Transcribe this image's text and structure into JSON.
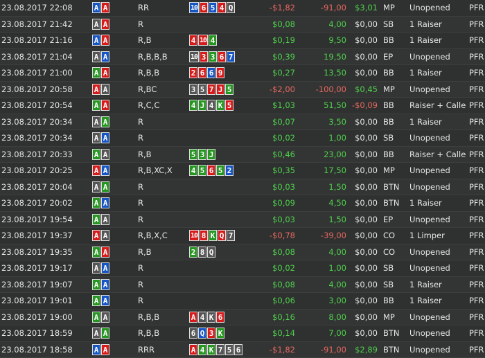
{
  "rows": [
    {
      "date": "23.08.2017 22:08",
      "hole": [
        [
          "A",
          "b"
        ],
        [
          "A",
          "r"
        ]
      ],
      "action": "RR",
      "board": [
        [
          "10",
          "b"
        ],
        [
          "6",
          "r"
        ],
        [
          "5",
          "b"
        ],
        [
          "4",
          "r"
        ],
        [
          "Q",
          "k"
        ]
      ],
      "net": "-$1,82",
      "net_c": "neg",
      "bb": "-91,00",
      "bb_c": "neg",
      "ev": "$3,01",
      "ev_c": "green",
      "pos": "MP",
      "sit": "Unopened",
      "pfr": "PFR"
    },
    {
      "date": "23.08.2017 21:42",
      "hole": [
        [
          "A",
          "k"
        ],
        [
          "A",
          "r"
        ]
      ],
      "action": "R",
      "board": [],
      "net": "$0,08",
      "net_c": "green",
      "bb": "4,00",
      "bb_c": "green",
      "ev": "$0,00",
      "ev_c": "zero",
      "pos": "SB",
      "sit": "1 Raiser",
      "pfr": "PFR"
    },
    {
      "date": "23.08.2017 21:16",
      "hole": [
        [
          "A",
          "b"
        ],
        [
          "A",
          "r"
        ]
      ],
      "action": "R,B",
      "board": [
        [
          "4",
          "r"
        ],
        [
          "10",
          "r"
        ],
        [
          "4",
          "g"
        ]
      ],
      "net": "$0,19",
      "net_c": "green",
      "bb": "9,50",
      "bb_c": "green",
      "ev": "$0,00",
      "ev_c": "zero",
      "pos": "BB",
      "sit": "1 Raiser",
      "pfr": "PFR"
    },
    {
      "date": "23.08.2017 21:04",
      "hole": [
        [
          "A",
          "k"
        ],
        [
          "A",
          "b"
        ]
      ],
      "action": "R,B,B,B",
      "board": [
        [
          "10",
          "k"
        ],
        [
          "3",
          "r"
        ],
        [
          "3",
          "g"
        ],
        [
          "6",
          "r"
        ],
        [
          "7",
          "b"
        ]
      ],
      "net": "$0,39",
      "net_c": "green",
      "bb": "19,50",
      "bb_c": "green",
      "ev": "$0,00",
      "ev_c": "zero",
      "pos": "EP",
      "sit": "Unopened",
      "pfr": "PFR"
    },
    {
      "date": "23.08.2017 21:00",
      "hole": [
        [
          "A",
          "g"
        ],
        [
          "A",
          "r"
        ]
      ],
      "action": "R,B,B",
      "board": [
        [
          "2",
          "r"
        ],
        [
          "6",
          "r"
        ],
        [
          "6",
          "b"
        ],
        [
          "9",
          "r"
        ]
      ],
      "net": "$0,27",
      "net_c": "green",
      "bb": "13,50",
      "bb_c": "green",
      "ev": "$0,00",
      "ev_c": "zero",
      "pos": "BB",
      "sit": "1 Raiser",
      "pfr": "PFR"
    },
    {
      "date": "23.08.2017 20:58",
      "hole": [
        [
          "A",
          "r"
        ],
        [
          "A",
          "k"
        ]
      ],
      "action": "R,BC",
      "board": [
        [
          "3",
          "k"
        ],
        [
          "5",
          "k"
        ],
        [
          "7",
          "r"
        ],
        [
          "J",
          "r"
        ],
        [
          "5",
          "g"
        ]
      ],
      "net": "-$2,00",
      "net_c": "neg",
      "bb": "-100,00",
      "bb_c": "neg",
      "ev": "$0,45",
      "ev_c": "green",
      "pos": "MP",
      "sit": "Unopened",
      "pfr": "PFR"
    },
    {
      "date": "23.08.2017 20:54",
      "hole": [
        [
          "A",
          "g"
        ],
        [
          "A",
          "r"
        ]
      ],
      "action": "R,C,C",
      "board": [
        [
          "4",
          "g"
        ],
        [
          "J",
          "g"
        ],
        [
          "4",
          "k"
        ],
        [
          "K",
          "g"
        ],
        [
          "5",
          "r"
        ]
      ],
      "net": "$1,03",
      "net_c": "green",
      "bb": "51,50",
      "bb_c": "green",
      "ev": "-$0,09",
      "ev_c": "neg",
      "pos": "BB",
      "sit": "Raiser + Callers",
      "pfr": "PFR"
    },
    {
      "date": "23.08.2017 20:34",
      "hole": [
        [
          "A",
          "k"
        ],
        [
          "A",
          "g"
        ]
      ],
      "action": "R",
      "board": [],
      "net": "$0,07",
      "net_c": "green",
      "bb": "3,50",
      "bb_c": "green",
      "ev": "$0,00",
      "ev_c": "zero",
      "pos": "BB",
      "sit": "1 Raiser",
      "pfr": "PFR"
    },
    {
      "date": "23.08.2017 20:34",
      "hole": [
        [
          "A",
          "k"
        ],
        [
          "A",
          "b"
        ]
      ],
      "action": "R",
      "board": [],
      "net": "$0,02",
      "net_c": "green",
      "bb": "1,00",
      "bb_c": "green",
      "ev": "$0,00",
      "ev_c": "zero",
      "pos": "SB",
      "sit": "Unopened",
      "pfr": "PFR"
    },
    {
      "date": "23.08.2017 20:33",
      "hole": [
        [
          "A",
          "g"
        ],
        [
          "A",
          "k"
        ]
      ],
      "action": "R,B",
      "board": [
        [
          "5",
          "g"
        ],
        [
          "3",
          "g"
        ],
        [
          "J",
          "g"
        ]
      ],
      "net": "$0,46",
      "net_c": "green",
      "bb": "23,00",
      "bb_c": "green",
      "ev": "$0,00",
      "ev_c": "zero",
      "pos": "BB",
      "sit": "Raiser + Callers",
      "pfr": "PFR"
    },
    {
      "date": "23.08.2017 20:25",
      "hole": [
        [
          "A",
          "r"
        ],
        [
          "A",
          "b"
        ]
      ],
      "action": "R,B,XC,X",
      "board": [
        [
          "4",
          "g"
        ],
        [
          "5",
          "g"
        ],
        [
          "6",
          "r"
        ],
        [
          "5",
          "g"
        ],
        [
          "2",
          "b"
        ]
      ],
      "net": "$0,35",
      "net_c": "green",
      "bb": "17,50",
      "bb_c": "green",
      "ev": "$0,00",
      "ev_c": "zero",
      "pos": "MP",
      "sit": "Unopened",
      "pfr": "PFR"
    },
    {
      "date": "23.08.2017 20:04",
      "hole": [
        [
          "A",
          "k"
        ],
        [
          "A",
          "g"
        ]
      ],
      "action": "R",
      "board": [],
      "net": "$0,03",
      "net_c": "green",
      "bb": "1,50",
      "bb_c": "green",
      "ev": "$0,00",
      "ev_c": "zero",
      "pos": "BTN",
      "sit": "Unopened",
      "pfr": "PFR"
    },
    {
      "date": "23.08.2017 20:02",
      "hole": [
        [
          "A",
          "g"
        ],
        [
          "A",
          "b"
        ]
      ],
      "action": "R",
      "board": [],
      "net": "$0,09",
      "net_c": "green",
      "bb": "4,50",
      "bb_c": "green",
      "ev": "$0,00",
      "ev_c": "zero",
      "pos": "BTN",
      "sit": "1 Raiser",
      "pfr": "PFR"
    },
    {
      "date": "23.08.2017 19:54",
      "hole": [
        [
          "A",
          "g"
        ],
        [
          "A",
          "k"
        ]
      ],
      "action": "R",
      "board": [],
      "net": "$0,03",
      "net_c": "green",
      "bb": "1,50",
      "bb_c": "green",
      "ev": "$0,00",
      "ev_c": "zero",
      "pos": "EP",
      "sit": "Unopened",
      "pfr": "PFR"
    },
    {
      "date": "23.08.2017 19:37",
      "hole": [
        [
          "A",
          "r"
        ],
        [
          "A",
          "k"
        ]
      ],
      "action": "R,B,X,C",
      "board": [
        [
          "10",
          "r"
        ],
        [
          "8",
          "r"
        ],
        [
          "K",
          "g"
        ],
        [
          "Q",
          "r"
        ],
        [
          "7",
          "k"
        ]
      ],
      "net": "-$0,78",
      "net_c": "neg",
      "bb": "-39,00",
      "bb_c": "neg",
      "ev": "$0,00",
      "ev_c": "zero",
      "pos": "CO",
      "sit": "1 Limper",
      "pfr": "PFR"
    },
    {
      "date": "23.08.2017 19:35",
      "hole": [
        [
          "A",
          "g"
        ],
        [
          "A",
          "r"
        ]
      ],
      "action": "R,B",
      "board": [
        [
          "2",
          "g"
        ],
        [
          "8",
          "k"
        ],
        [
          "Q",
          "k"
        ]
      ],
      "net": "$0,08",
      "net_c": "green",
      "bb": "4,00",
      "bb_c": "green",
      "ev": "$0,00",
      "ev_c": "zero",
      "pos": "CO",
      "sit": "Unopened",
      "pfr": "PFR"
    },
    {
      "date": "23.08.2017 19:17",
      "hole": [
        [
          "A",
          "k"
        ],
        [
          "A",
          "b"
        ]
      ],
      "action": "R",
      "board": [],
      "net": "$0,02",
      "net_c": "green",
      "bb": "1,00",
      "bb_c": "green",
      "ev": "$0,00",
      "ev_c": "zero",
      "pos": "SB",
      "sit": "Unopened",
      "pfr": "PFR"
    },
    {
      "date": "23.08.2017 19:07",
      "hole": [
        [
          "A",
          "g"
        ],
        [
          "A",
          "b"
        ]
      ],
      "action": "R",
      "board": [],
      "net": "$0,08",
      "net_c": "green",
      "bb": "4,00",
      "bb_c": "green",
      "ev": "$0,00",
      "ev_c": "zero",
      "pos": "SB",
      "sit": "1 Raiser",
      "pfr": "PFR"
    },
    {
      "date": "23.08.2017 19:01",
      "hole": [
        [
          "A",
          "g"
        ],
        [
          "A",
          "b"
        ]
      ],
      "action": "R",
      "board": [],
      "net": "$0,06",
      "net_c": "green",
      "bb": "3,00",
      "bb_c": "green",
      "ev": "$0,00",
      "ev_c": "zero",
      "pos": "BB",
      "sit": "1 Raiser",
      "pfr": "PFR"
    },
    {
      "date": "23.08.2017 19:00",
      "hole": [
        [
          "A",
          "g"
        ],
        [
          "A",
          "k"
        ]
      ],
      "action": "R,B,B",
      "board": [
        [
          "A",
          "r"
        ],
        [
          "4",
          "k"
        ],
        [
          "K",
          "k"
        ],
        [
          "6",
          "r"
        ]
      ],
      "net": "$0,16",
      "net_c": "green",
      "bb": "8,00",
      "bb_c": "green",
      "ev": "$0,00",
      "ev_c": "zero",
      "pos": "MP",
      "sit": "Unopened",
      "pfr": "PFR"
    },
    {
      "date": "23.08.2017 18:59",
      "hole": [
        [
          "A",
          "k"
        ],
        [
          "A",
          "g"
        ]
      ],
      "action": "R,B,B",
      "board": [
        [
          "6",
          "k"
        ],
        [
          "Q",
          "b"
        ],
        [
          "3",
          "r"
        ],
        [
          "K",
          "g"
        ]
      ],
      "net": "$0,14",
      "net_c": "green",
      "bb": "7,00",
      "bb_c": "green",
      "ev": "$0,00",
      "ev_c": "zero",
      "pos": "BTN",
      "sit": "Unopened",
      "pfr": "PFR"
    },
    {
      "date": "23.08.2017 18:58",
      "hole": [
        [
          "A",
          "b"
        ],
        [
          "A",
          "r"
        ]
      ],
      "action": "RRR",
      "board": [
        [
          "A",
          "r"
        ],
        [
          "4",
          "g"
        ],
        [
          "K",
          "g"
        ],
        [
          "7",
          "k"
        ],
        [
          "5",
          "k"
        ],
        [
          "6",
          "k"
        ]
      ],
      "net": "-$1,82",
      "net_c": "neg",
      "bb": "-91,00",
      "bb_c": "neg",
      "ev": "$2,89",
      "ev_c": "green",
      "pos": "BTN",
      "sit": "Unopened",
      "pfr": "PFR"
    }
  ]
}
